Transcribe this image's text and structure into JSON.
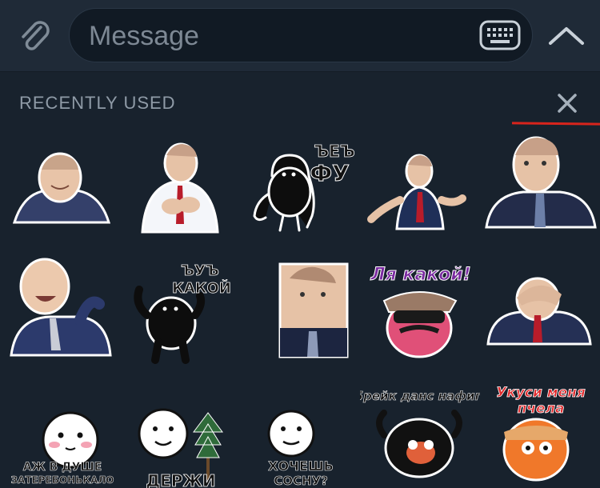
{
  "composer": {
    "placeholder": "Message",
    "icons": {
      "attach": "paperclip-icon",
      "keyboard": "keyboard-icon",
      "collapse": "chevron-up-icon"
    }
  },
  "panel": {
    "title": "RECENTLY USED",
    "close_icon": "close-icon"
  },
  "stickers": {
    "s3_text": "ЪЕЪ",
    "s3_text2": "ФУ",
    "s7_text": "ЪУЪ",
    "s7_text2": "КАКОЙ",
    "s9_text": "Ля какой!",
    "s11_text": "АЖ В ДУШЕ",
    "s11_text2": "ЗАТЕРЕБОНЬКАЛО",
    "s12_text": "ДЕРЖИ",
    "s13_text": "ХОЧЕШЬ",
    "s13_text2": "СОСНУ?",
    "s14_text": "Брейк данс нафиг",
    "s15_text": "Укуси меня",
    "s15_text2": "пчела"
  },
  "colors": {
    "background": "#18222d",
    "bar": "#1f2a37",
    "accent_red": "#d8241c"
  }
}
